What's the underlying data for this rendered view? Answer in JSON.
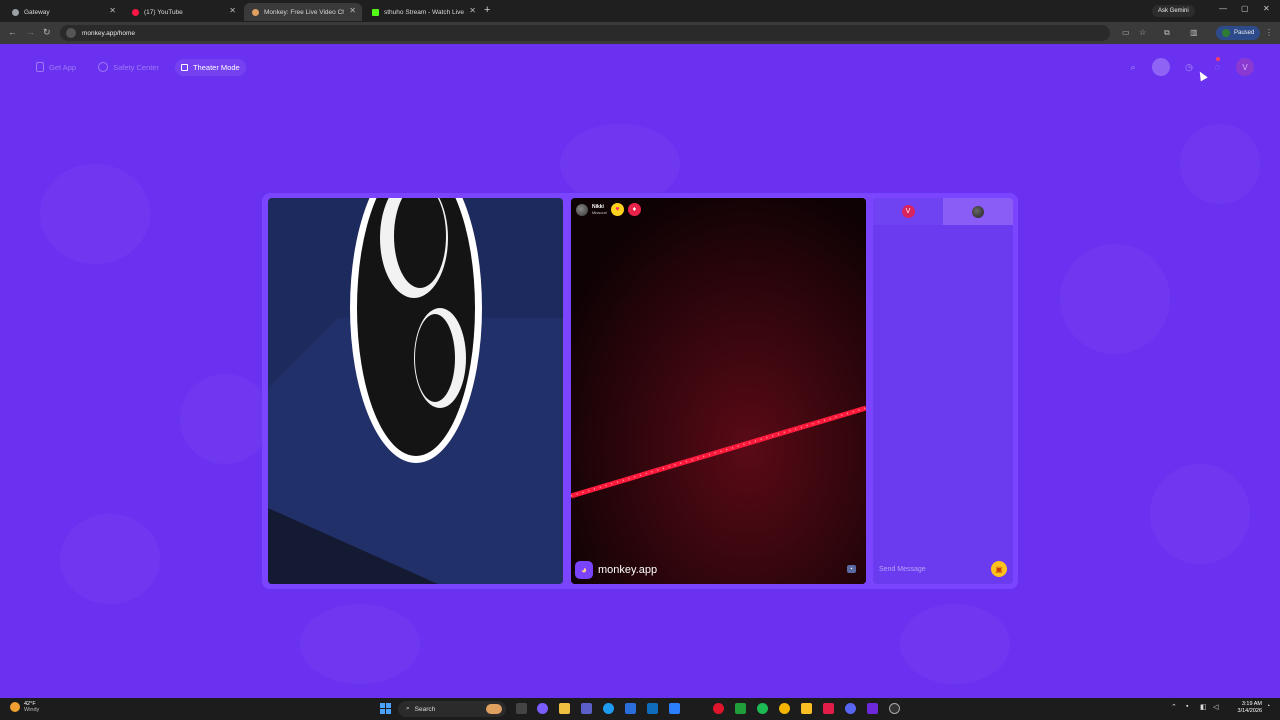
{
  "browser": {
    "tabs": [
      {
        "title": "Gateway",
        "color": "#9aa0a6"
      },
      {
        "title": "(17) YouTube",
        "color": "#ff1744"
      },
      {
        "title": "Monkey: Free Live Video Chat",
        "color": "#e0a060"
      },
      {
        "title": "sthuho Stream - Watch Live on",
        "color": "#53fc18"
      }
    ],
    "new_tab": "+",
    "ask_gemini": "Ask Gemini",
    "url": "monkey.app/home",
    "profile_status": "Paused"
  },
  "nav": {
    "get_app": "Get App",
    "safety_center": "Safety Center",
    "theater_mode": "Theater Mode",
    "avatar_letter": "V"
  },
  "video_peer": {
    "name": "Nikki",
    "location": "Missouri",
    "watermark": "monkey.app"
  },
  "chat": {
    "self_initial": "V",
    "send_placeholder": "Send Message"
  },
  "taskbar": {
    "temperature": "42°F",
    "condition": "Windy",
    "search": "Search",
    "time": "3:19 AM",
    "date": "3/14/2026"
  },
  "colors": {
    "page_bg": "#6a31f0",
    "stage_bg": "#7b44ff",
    "chat_bg": "#6b3cef",
    "accent_red": "#d9245e",
    "gift_yellow": "#ffc21a"
  }
}
